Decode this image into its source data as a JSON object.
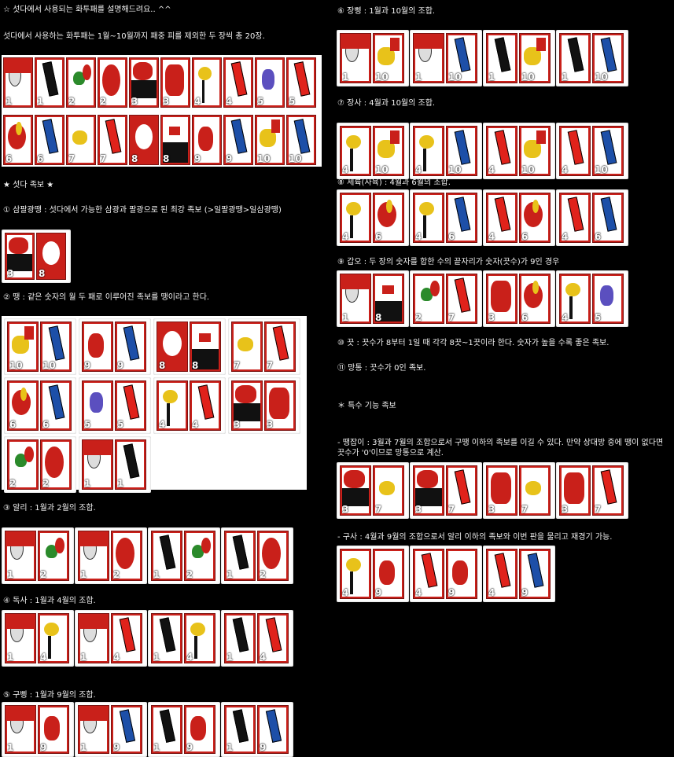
{
  "texts": {
    "intro_title": "☆ 섯다에서 사용되는 화투패를 설명해드려요.. ^^",
    "intro_desc": "섯다에서 사용하는 화투패는 1월~10월까지 패중 피를 제외한 두 장씩 총 20장.",
    "section_title": "★ 섯다 족보 ★",
    "rule1": "① 삼팔광땡 : 섯다에서 가능한 삼광과 팔광으로 된 최강 족보 (>일팔광땡>일삼광땡)",
    "rule2": "② 땡 : 같은 숫자의 월 두 패로 이루어진 족보를 땡이라고 한다.",
    "rule3": "③ 알리 : 1월과 2월의 조합.",
    "rule4": "④ 독사 : 1월과 4월의 조합.",
    "rule5": "⑤ 구삥 : 1월과 9월의 조합.",
    "rule6": "⑥ 장삥 : 1월과 10월의 조합.",
    "rule7": "⑦ 장사 : 4월과 10월의 조합.",
    "rule8": "⑧ 세륙(사육) : 4월과 6월의 조합.",
    "rule9": "⑨ 갑오 : 두 장의 숫자를 합한 수의 끝자리가 숫자(끗수)가 9인 경우",
    "rule10": "⑩ 끗 : 끗수가 8부터 1일 때 각각 8끗~1끗이라 한다. 숫자가 높을 수록 좋은 족보.",
    "rule11": "⑪ 망통 : 끗수가 0인 족보.",
    "special_title": "＊ 특수 기능 족보",
    "special1": "- 땡잡이 : 3월과 7월의 조합으로서 구땡 이하의 족보를 이길 수 있다. 만약 상대방 중에 땡이 없다면 끗수가 '0'이므로 망통으로 계산.",
    "special2": "- 구사 : 4월과 9월의 조합으로서 알리 이하의 족보와 이번 판을 물리고 재경기 가능."
  },
  "deck_row1": [
    {
      "n": "1",
      "m": 1,
      "v": "a"
    },
    {
      "n": "1",
      "m": 1,
      "v": "b"
    },
    {
      "n": "2",
      "m": 2,
      "v": "a"
    },
    {
      "n": "2",
      "m": 2,
      "v": "b"
    },
    {
      "n": "3",
      "m": 3,
      "v": "a"
    },
    {
      "n": "3",
      "m": 3,
      "v": "b"
    },
    {
      "n": "4",
      "m": 4,
      "v": "a"
    },
    {
      "n": "4",
      "m": 4,
      "v": "b"
    },
    {
      "n": "5",
      "m": 5,
      "v": "a"
    },
    {
      "n": "5",
      "m": 5,
      "v": "b"
    }
  ],
  "deck_row2": [
    {
      "n": "6",
      "m": 6,
      "v": "a"
    },
    {
      "n": "6",
      "m": 6,
      "v": "b"
    },
    {
      "n": "7",
      "m": 7,
      "v": "a"
    },
    {
      "n": "7",
      "m": 7,
      "v": "b"
    },
    {
      "n": "8",
      "m": 8,
      "v": "a"
    },
    {
      "n": "8",
      "m": 8,
      "v": "b"
    },
    {
      "n": "9",
      "m": 9,
      "v": "a"
    },
    {
      "n": "9",
      "m": 9,
      "v": "b"
    },
    {
      "n": "10",
      "m": 10,
      "v": "a"
    },
    {
      "n": "10",
      "m": 10,
      "v": "b"
    }
  ],
  "hands": {
    "gwangttaeng": [
      [
        {
          "n": "3",
          "m": 3,
          "v": "a"
        },
        {
          "n": "8",
          "m": 8,
          "v": "a"
        }
      ]
    ],
    "ttaeng": [
      [
        {
          "n": "10",
          "m": 10,
          "v": "a"
        },
        {
          "n": "10",
          "m": 10,
          "v": "b"
        }
      ],
      [
        {
          "n": "9",
          "m": 9,
          "v": "a"
        },
        {
          "n": "9",
          "m": 9,
          "v": "b"
        }
      ],
      [
        {
          "n": "8",
          "m": 8,
          "v": "a"
        },
        {
          "n": "8",
          "m": 8,
          "v": "b"
        }
      ],
      [
        {
          "n": "7",
          "m": 7,
          "v": "a"
        },
        {
          "n": "7",
          "m": 7,
          "v": "b"
        }
      ],
      [
        {
          "n": "6",
          "m": 6,
          "v": "a"
        },
        {
          "n": "6",
          "m": 6,
          "v": "b"
        }
      ],
      [
        {
          "n": "5",
          "m": 5,
          "v": "a"
        },
        {
          "n": "5",
          "m": 5,
          "v": "b"
        }
      ],
      [
        {
          "n": "4",
          "m": 4,
          "v": "a"
        },
        {
          "n": "4",
          "m": 4,
          "v": "b"
        }
      ],
      [
        {
          "n": "3",
          "m": 3,
          "v": "a"
        },
        {
          "n": "3",
          "m": 3,
          "v": "b"
        }
      ],
      [
        {
          "n": "2",
          "m": 2,
          "v": "a"
        },
        {
          "n": "2",
          "m": 2,
          "v": "b"
        }
      ],
      [
        {
          "n": "1",
          "m": 1,
          "v": "a"
        },
        {
          "n": "1",
          "m": 1,
          "v": "b"
        }
      ]
    ],
    "alli": [
      [
        {
          "n": "1",
          "m": 1,
          "v": "a"
        },
        {
          "n": "2",
          "m": 2,
          "v": "a"
        }
      ],
      [
        {
          "n": "1",
          "m": 1,
          "v": "a"
        },
        {
          "n": "2",
          "m": 2,
          "v": "b"
        }
      ],
      [
        {
          "n": "1",
          "m": 1,
          "v": "b"
        },
        {
          "n": "2",
          "m": 2,
          "v": "a"
        }
      ],
      [
        {
          "n": "1",
          "m": 1,
          "v": "b"
        },
        {
          "n": "2",
          "m": 2,
          "v": "b"
        }
      ]
    ],
    "doksa": [
      [
        {
          "n": "1",
          "m": 1,
          "v": "a"
        },
        {
          "n": "4",
          "m": 4,
          "v": "a"
        }
      ],
      [
        {
          "n": "1",
          "m": 1,
          "v": "a"
        },
        {
          "n": "4",
          "m": 4,
          "v": "b"
        }
      ],
      [
        {
          "n": "1",
          "m": 1,
          "v": "b"
        },
        {
          "n": "4",
          "m": 4,
          "v": "a"
        }
      ],
      [
        {
          "n": "1",
          "m": 1,
          "v": "b"
        },
        {
          "n": "4",
          "m": 4,
          "v": "b"
        }
      ]
    ],
    "gupping": [
      [
        {
          "n": "1",
          "m": 1,
          "v": "a"
        },
        {
          "n": "9",
          "m": 9,
          "v": "a"
        }
      ],
      [
        {
          "n": "1",
          "m": 1,
          "v": "a"
        },
        {
          "n": "9",
          "m": 9,
          "v": "b"
        }
      ],
      [
        {
          "n": "1",
          "m": 1,
          "v": "b"
        },
        {
          "n": "9",
          "m": 9,
          "v": "a"
        }
      ],
      [
        {
          "n": "1",
          "m": 1,
          "v": "b"
        },
        {
          "n": "9",
          "m": 9,
          "v": "b"
        }
      ]
    ],
    "jangpping": [
      [
        {
          "n": "1",
          "m": 1,
          "v": "a"
        },
        {
          "n": "10",
          "m": 10,
          "v": "a"
        }
      ],
      [
        {
          "n": "1",
          "m": 1,
          "v": "a"
        },
        {
          "n": "10",
          "m": 10,
          "v": "b"
        }
      ],
      [
        {
          "n": "1",
          "m": 1,
          "v": "b"
        },
        {
          "n": "10",
          "m": 10,
          "v": "a"
        }
      ],
      [
        {
          "n": "1",
          "m": 1,
          "v": "b"
        },
        {
          "n": "10",
          "m": 10,
          "v": "b"
        }
      ]
    ],
    "jangsa": [
      [
        {
          "n": "4",
          "m": 4,
          "v": "a"
        },
        {
          "n": "10",
          "m": 10,
          "v": "a"
        }
      ],
      [
        {
          "n": "4",
          "m": 4,
          "v": "a"
        },
        {
          "n": "10",
          "m": 10,
          "v": "b"
        }
      ],
      [
        {
          "n": "4",
          "m": 4,
          "v": "b"
        },
        {
          "n": "10",
          "m": 10,
          "v": "a"
        }
      ],
      [
        {
          "n": "4",
          "m": 4,
          "v": "b"
        },
        {
          "n": "10",
          "m": 10,
          "v": "b"
        }
      ]
    ],
    "seryuk": [
      [
        {
          "n": "4",
          "m": 4,
          "v": "a"
        },
        {
          "n": "6",
          "m": 6,
          "v": "a"
        }
      ],
      [
        {
          "n": "4",
          "m": 4,
          "v": "a"
        },
        {
          "n": "6",
          "m": 6,
          "v": "b"
        }
      ],
      [
        {
          "n": "4",
          "m": 4,
          "v": "b"
        },
        {
          "n": "6",
          "m": 6,
          "v": "a"
        }
      ],
      [
        {
          "n": "4",
          "m": 4,
          "v": "b"
        },
        {
          "n": "6",
          "m": 6,
          "v": "b"
        }
      ]
    ],
    "gabo": [
      [
        {
          "n": "1",
          "m": 1,
          "v": "a"
        },
        {
          "n": "8",
          "m": 8,
          "v": "b"
        }
      ],
      [
        {
          "n": "2",
          "m": 2,
          "v": "a"
        },
        {
          "n": "7",
          "m": 7,
          "v": "b"
        }
      ],
      [
        {
          "n": "3",
          "m": 3,
          "v": "b"
        },
        {
          "n": "6",
          "m": 6,
          "v": "a"
        }
      ],
      [
        {
          "n": "4",
          "m": 4,
          "v": "a"
        },
        {
          "n": "5",
          "m": 5,
          "v": "a"
        }
      ]
    ],
    "ttaengjabi": [
      [
        {
          "n": "3",
          "m": 3,
          "v": "a"
        },
        {
          "n": "7",
          "m": 7,
          "v": "a"
        }
      ],
      [
        {
          "n": "3",
          "m": 3,
          "v": "a"
        },
        {
          "n": "7",
          "m": 7,
          "v": "b"
        }
      ],
      [
        {
          "n": "3",
          "m": 3,
          "v": "b"
        },
        {
          "n": "7",
          "m": 7,
          "v": "a"
        }
      ],
      [
        {
          "n": "3",
          "m": 3,
          "v": "b"
        },
        {
          "n": "7",
          "m": 7,
          "v": "b"
        }
      ]
    ],
    "gusa": [
      [
        {
          "n": "4",
          "m": 4,
          "v": "a"
        },
        {
          "n": "9",
          "m": 9,
          "v": "a"
        }
      ],
      [
        {
          "n": "4",
          "m": 4,
          "v": "b"
        },
        {
          "n": "9",
          "m": 9,
          "v": "a"
        }
      ],
      [
        {
          "n": "4",
          "m": 4,
          "v": "b"
        },
        {
          "n": "9",
          "m": 9,
          "v": "b"
        }
      ]
    ]
  },
  "colors": {
    "card_red": "#c9201a",
    "ribbon_red": "#e0221b",
    "ribbon_blue": "#1d4fa8",
    "moon": "#ffffff",
    "bird_yellow": "#e8c21a",
    "leaf_green": "#2b8a2b",
    "black": "#111111"
  }
}
